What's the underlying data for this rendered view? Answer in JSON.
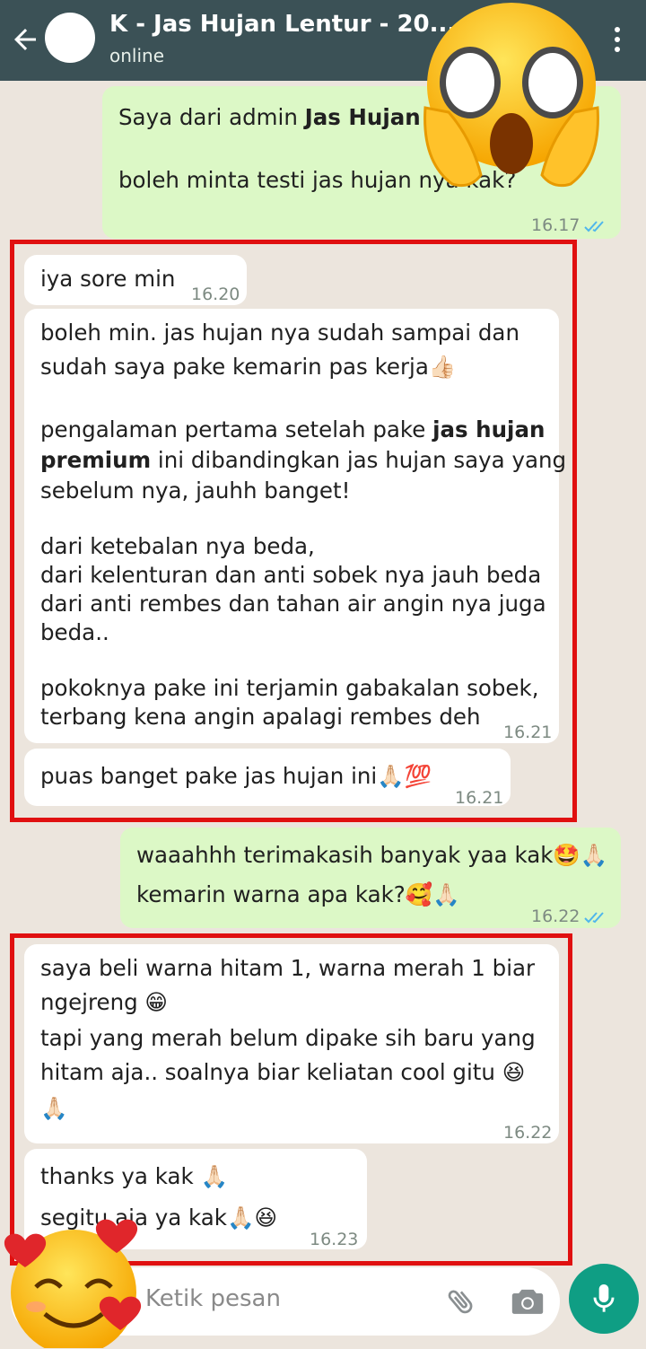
{
  "header": {
    "title": "K - Jas Hujan Lentur - 20...",
    "status": "online"
  },
  "messages": {
    "m1": {
      "line1_prefix": "Saya dari admin ",
      "line1_bold": "Jas Hujan Le",
      "line2": "boleh minta testi jas hujan nya kak?",
      "time": "16.17"
    },
    "m2": {
      "text": "iya sore min",
      "time": "16.20"
    },
    "m3": {
      "l1": "boleh min. jas hujan nya sudah sampai dan",
      "l2": "sudah saya pake kemarin pas kerja👍🏻",
      "l3": "pengalaman pertama setelah pake ",
      "l3_bold": "jas hujan",
      "l4_bold": "premium",
      "l4": " ini dibandingkan jas hujan saya yang",
      "l5": "sebelum nya, jauhh banget!",
      "l6": "dari ketebalan nya beda,",
      "l7": "dari kelenturan dan anti sobek nya jauh beda",
      "l8": "dari anti rembes dan tahan air angin nya juga",
      "l9": "beda..",
      "l10": "pokoknya pake ini terjamin gabakalan sobek,",
      "l11": "terbang kena angin apalagi rembes deh",
      "time": "16.21"
    },
    "m4": {
      "text": "puas banget pake jas hujan ini🙏🏻💯",
      "time": "16.21"
    },
    "m5": {
      "l1": "waaahhh terimakasih banyak yaa kak🤩🙏🏻",
      "l2": "kemarin warna apa kak?🥰🙏🏻",
      "time": "16.22"
    },
    "m6": {
      "l1": "saya beli warna hitam 1, warna merah 1 biar",
      "l2": "ngejreng 😁",
      "l3": "tapi yang merah belum dipake sih baru yang",
      "l4": "hitam aja.. soalnya biar keliatan cool gitu 😆",
      "l5": "🙏🏻",
      "time": "16.22"
    },
    "m7": {
      "l1": "thanks ya kak 🙏🏻",
      "l2": "segitu aja ya kak🙏🏻😆",
      "time": "16.23"
    }
  },
  "input": {
    "placeholder": "Ketik pesan"
  },
  "colors": {
    "header": "#3b5156",
    "chat_bg": "#ece5dd",
    "outgoing_bubble": "#dcf8c6",
    "incoming_bubble": "#ffffff",
    "highlight_box": "#e01010",
    "mic_button": "#0f9e84",
    "read_ticks": "#4fb6ec"
  },
  "icons": {
    "back": "arrow-left-icon",
    "menu": "more-vert-icon",
    "attach": "paperclip-icon",
    "camera": "camera-icon",
    "mic": "microphone-icon",
    "sticker_top": "face-screaming-in-fear-emoji",
    "sticker_bottom": "smiling-face-with-hearts-emoji"
  }
}
